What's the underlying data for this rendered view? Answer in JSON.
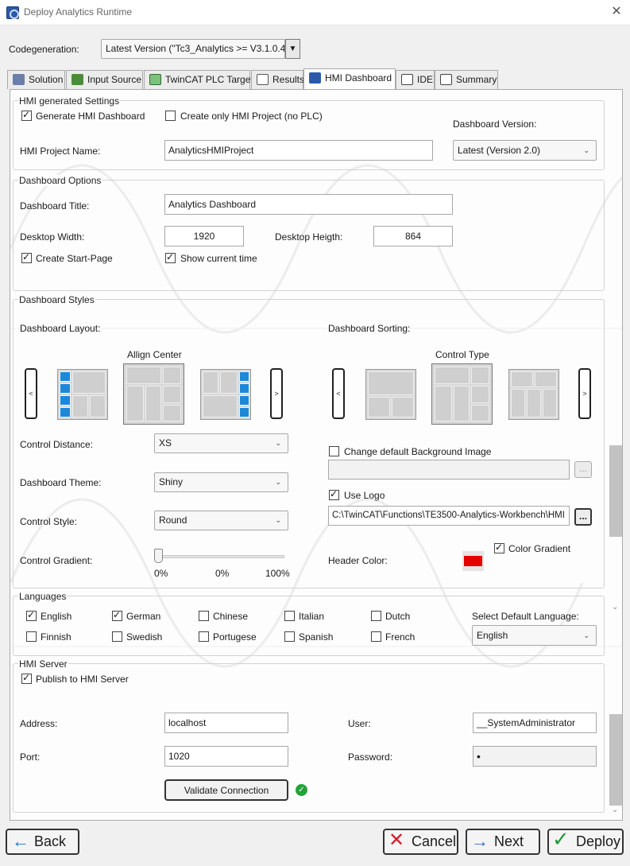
{
  "window": {
    "title": "Deploy Analytics Runtime"
  },
  "codegen": {
    "label": "Codegeneration:",
    "value": "Latest Version (\"Tc3_Analytics >= V3.1.0.4\""
  },
  "tabs": [
    {
      "label": "Solution",
      "icon": "solution-icon"
    },
    {
      "label": "Input Source",
      "icon": "input-source-icon"
    },
    {
      "label": "TwinCAT PLC Target",
      "icon": "plc-target-icon"
    },
    {
      "label": "Results",
      "icon": "results-icon"
    },
    {
      "label": "HMI Dashboard",
      "icon": "hmi-dashboard-icon",
      "active": true
    },
    {
      "label": "IDE",
      "icon": "ide-icon"
    },
    {
      "label": "Summary",
      "icon": "summary-icon"
    }
  ],
  "hmi_settings": {
    "title": "HMI generated Settings",
    "generate_dashboard": {
      "label": "Generate HMI Dashboard",
      "checked": true
    },
    "hmi_only": {
      "label": "Create only HMI Project (no PLC)",
      "checked": false
    },
    "version_label": "Dashboard Version:",
    "version_value": "Latest (Version 2.0)",
    "project_name_label": "HMI Project Name:",
    "project_name_value": "AnalyticsHMIProject"
  },
  "dashboard_options": {
    "title": "Dashboard Options",
    "title_label": "Dashboard Title:",
    "title_value": "Analytics Dashboard",
    "width_label": "Desktop Width:",
    "width_value": "1920",
    "height_label": "Desktop Heigth:",
    "height_value": "864",
    "start_page": {
      "label": "Create Start-Page",
      "checked": true
    },
    "show_time": {
      "label": "Show current time",
      "checked": true
    }
  },
  "dashboard_styles": {
    "title": "Dashboard Styles",
    "layout_label": "Dashboard Layout:",
    "layout_selected": "Allign Center",
    "sorting_label": "Dashboard Sorting:",
    "sorting_selected": "Control Type",
    "prev": "<",
    "next": ">",
    "distance_label": "Control Distance:",
    "distance_value": "XS",
    "theme_label": "Dashboard Theme:",
    "theme_value": "Shiny",
    "style_label": "Control Style:",
    "style_value": "Round",
    "gradient_label": "Control Gradient:",
    "gradient_ticks": [
      "0%",
      "0%",
      "100%"
    ],
    "gradient_level": 0,
    "bg_image": {
      "label": "Change default Background Image",
      "checked": false,
      "value": ""
    },
    "use_logo": {
      "label": "Use Logo",
      "checked": true,
      "value": "C:\\TwinCAT\\Functions\\TE3500-Analytics-Workbench\\HMI"
    },
    "browse_label": "...",
    "header_color_label": "Header Color:",
    "header_color": "#e60000",
    "color_gradient": {
      "label": "Color Gradient",
      "checked": true
    }
  },
  "languages": {
    "title": "Languages",
    "items": [
      {
        "label": "English",
        "checked": true
      },
      {
        "label": "German",
        "checked": true
      },
      {
        "label": "Chinese",
        "checked": false
      },
      {
        "label": "Italian",
        "checked": false
      },
      {
        "label": "Dutch",
        "checked": false
      },
      {
        "label": "Finnish",
        "checked": false
      },
      {
        "label": "Swedish",
        "checked": false
      },
      {
        "label": "Portugese",
        "checked": false
      },
      {
        "label": "Spanish",
        "checked": false
      },
      {
        "label": "French",
        "checked": false
      }
    ],
    "default_label": "Select Default Language:",
    "default_value": "English"
  },
  "hmi_server": {
    "title": "HMI Server",
    "publish": {
      "label": "Publish to HMI Server",
      "checked": true
    },
    "address_label": "Address:",
    "address_value": "localhost",
    "port_label": "Port:",
    "port_value": "1020",
    "user_label": "User:",
    "user_value": "__SystemAdministrator",
    "password_label": "Password:",
    "password_value": "•",
    "validate_label": "Validate Connection",
    "status_color": "#22a33a"
  },
  "footer": {
    "back": "Back",
    "cancel": "Cancel",
    "next": "Next",
    "deploy": "Deploy"
  },
  "colors": {
    "accent_blue": "#1e88d8",
    "cancel_red": "#d0202a",
    "next_blue": "#2a6dc9",
    "deploy_green": "#1f9b3a"
  }
}
